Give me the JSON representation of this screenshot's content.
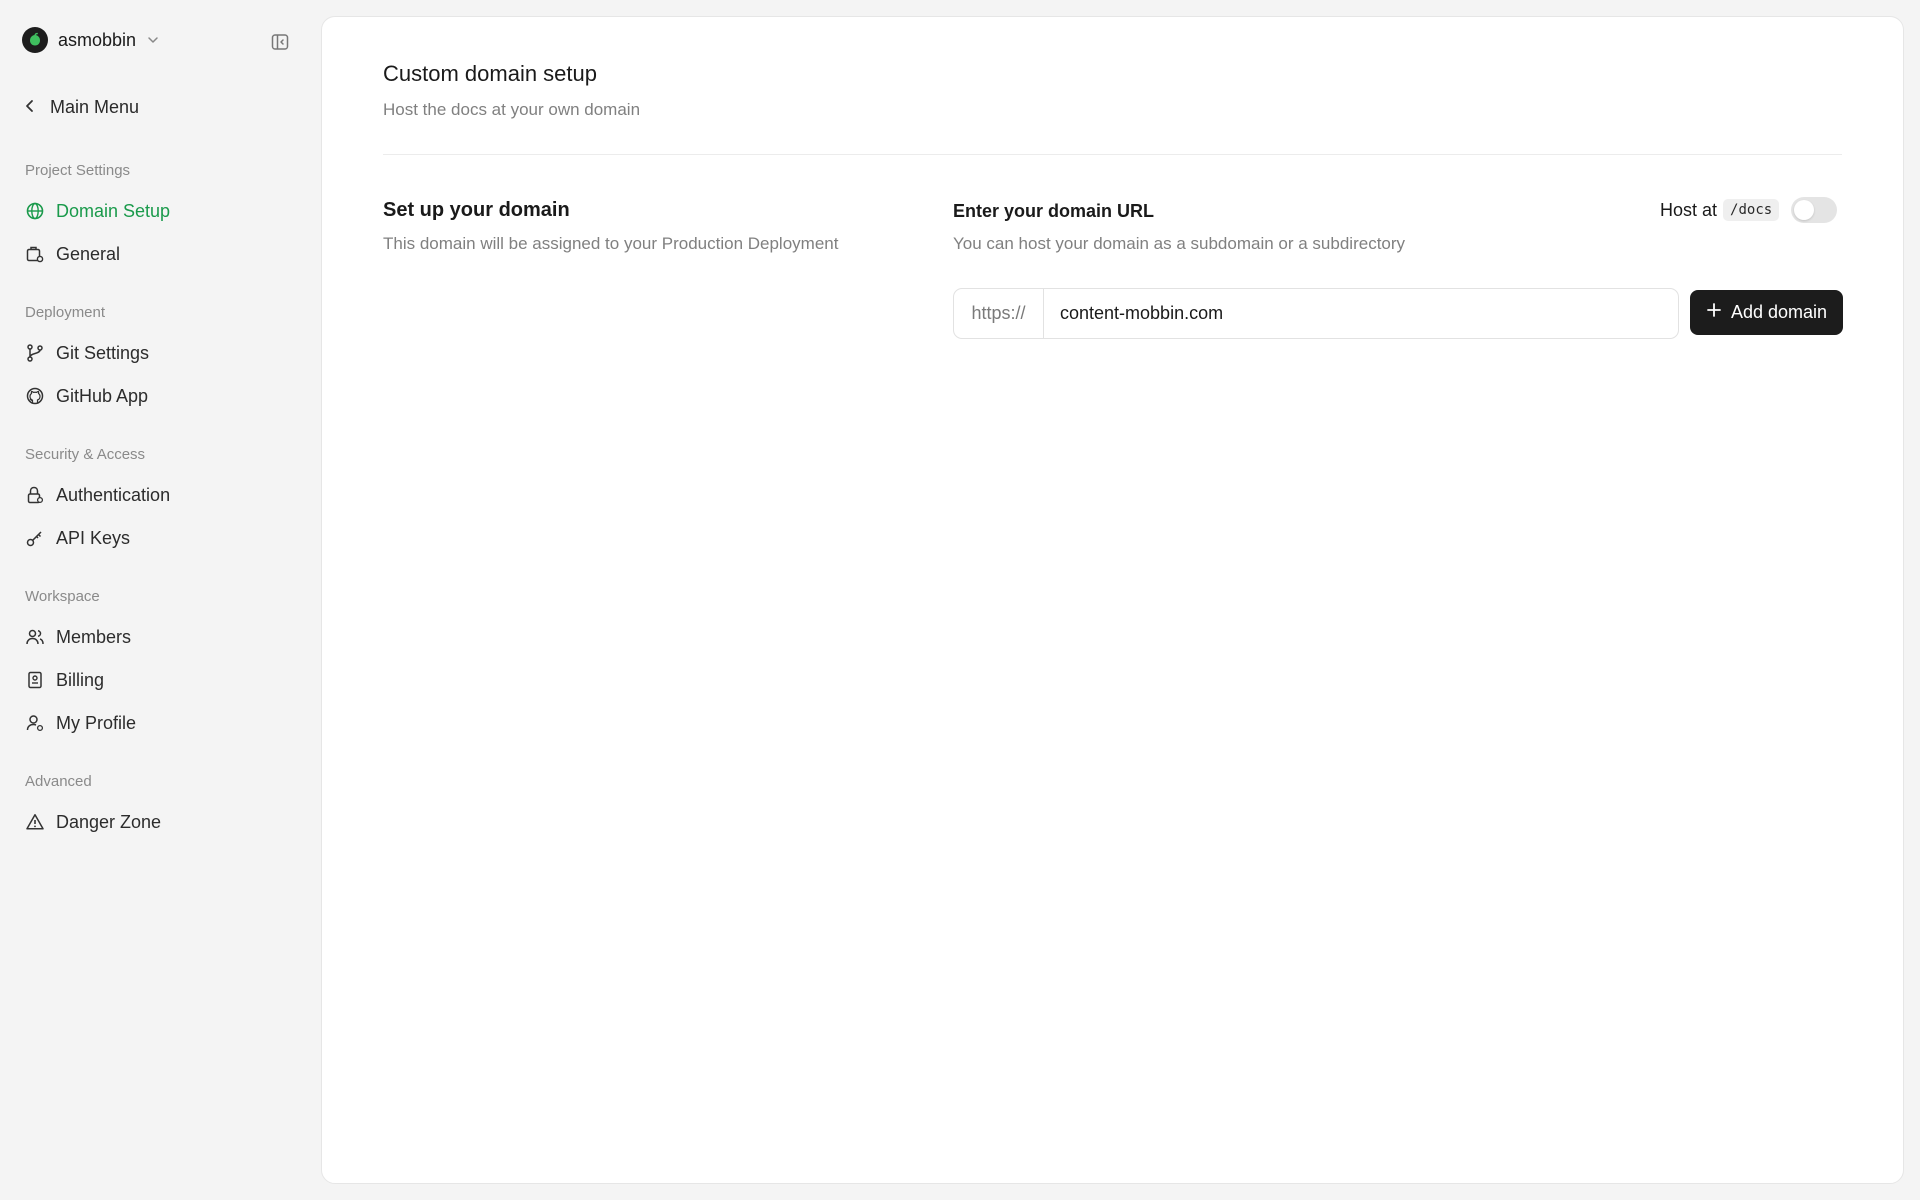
{
  "workspace": {
    "name": "asmobbin"
  },
  "sidebar": {
    "back_label": "Main Menu",
    "sections": [
      {
        "label": "Project Settings"
      },
      {
        "label": "Deployment"
      },
      {
        "label": "Security & Access"
      },
      {
        "label": "Workspace"
      },
      {
        "label": "Advanced"
      }
    ],
    "items": [
      {
        "label": "Domain Setup",
        "icon": "globe-icon",
        "active": true
      },
      {
        "label": "General",
        "icon": "settings-briefcase-icon"
      },
      {
        "label": "Git Settings",
        "icon": "git-branch-icon"
      },
      {
        "label": "GitHub App",
        "icon": "github-icon"
      },
      {
        "label": "Authentication",
        "icon": "lock-icon"
      },
      {
        "label": "API Keys",
        "icon": "key-icon"
      },
      {
        "label": "Members",
        "icon": "users-icon"
      },
      {
        "label": "Billing",
        "icon": "receipt-icon"
      },
      {
        "label": "My Profile",
        "icon": "user-gear-icon"
      },
      {
        "label": "Danger Zone",
        "icon": "warning-icon"
      }
    ]
  },
  "main": {
    "title": "Custom domain setup",
    "subtitle": "Host the docs at your own domain",
    "section_title": "Set up your domain",
    "section_desc": "This domain will be assigned to your Production Deployment",
    "field_label": "Enter your domain URL",
    "field_help": "You can host your domain as a subdomain or a subdirectory",
    "host_at_label": "Host at",
    "host_at_path": "/docs",
    "host_at_enabled": false,
    "url_prefix": "https://",
    "url_value": "content-mobbin.com",
    "add_button_label": "Add domain"
  },
  "colors": {
    "accent": "#1a9a4b",
    "button_bg": "#1c1c1c"
  }
}
